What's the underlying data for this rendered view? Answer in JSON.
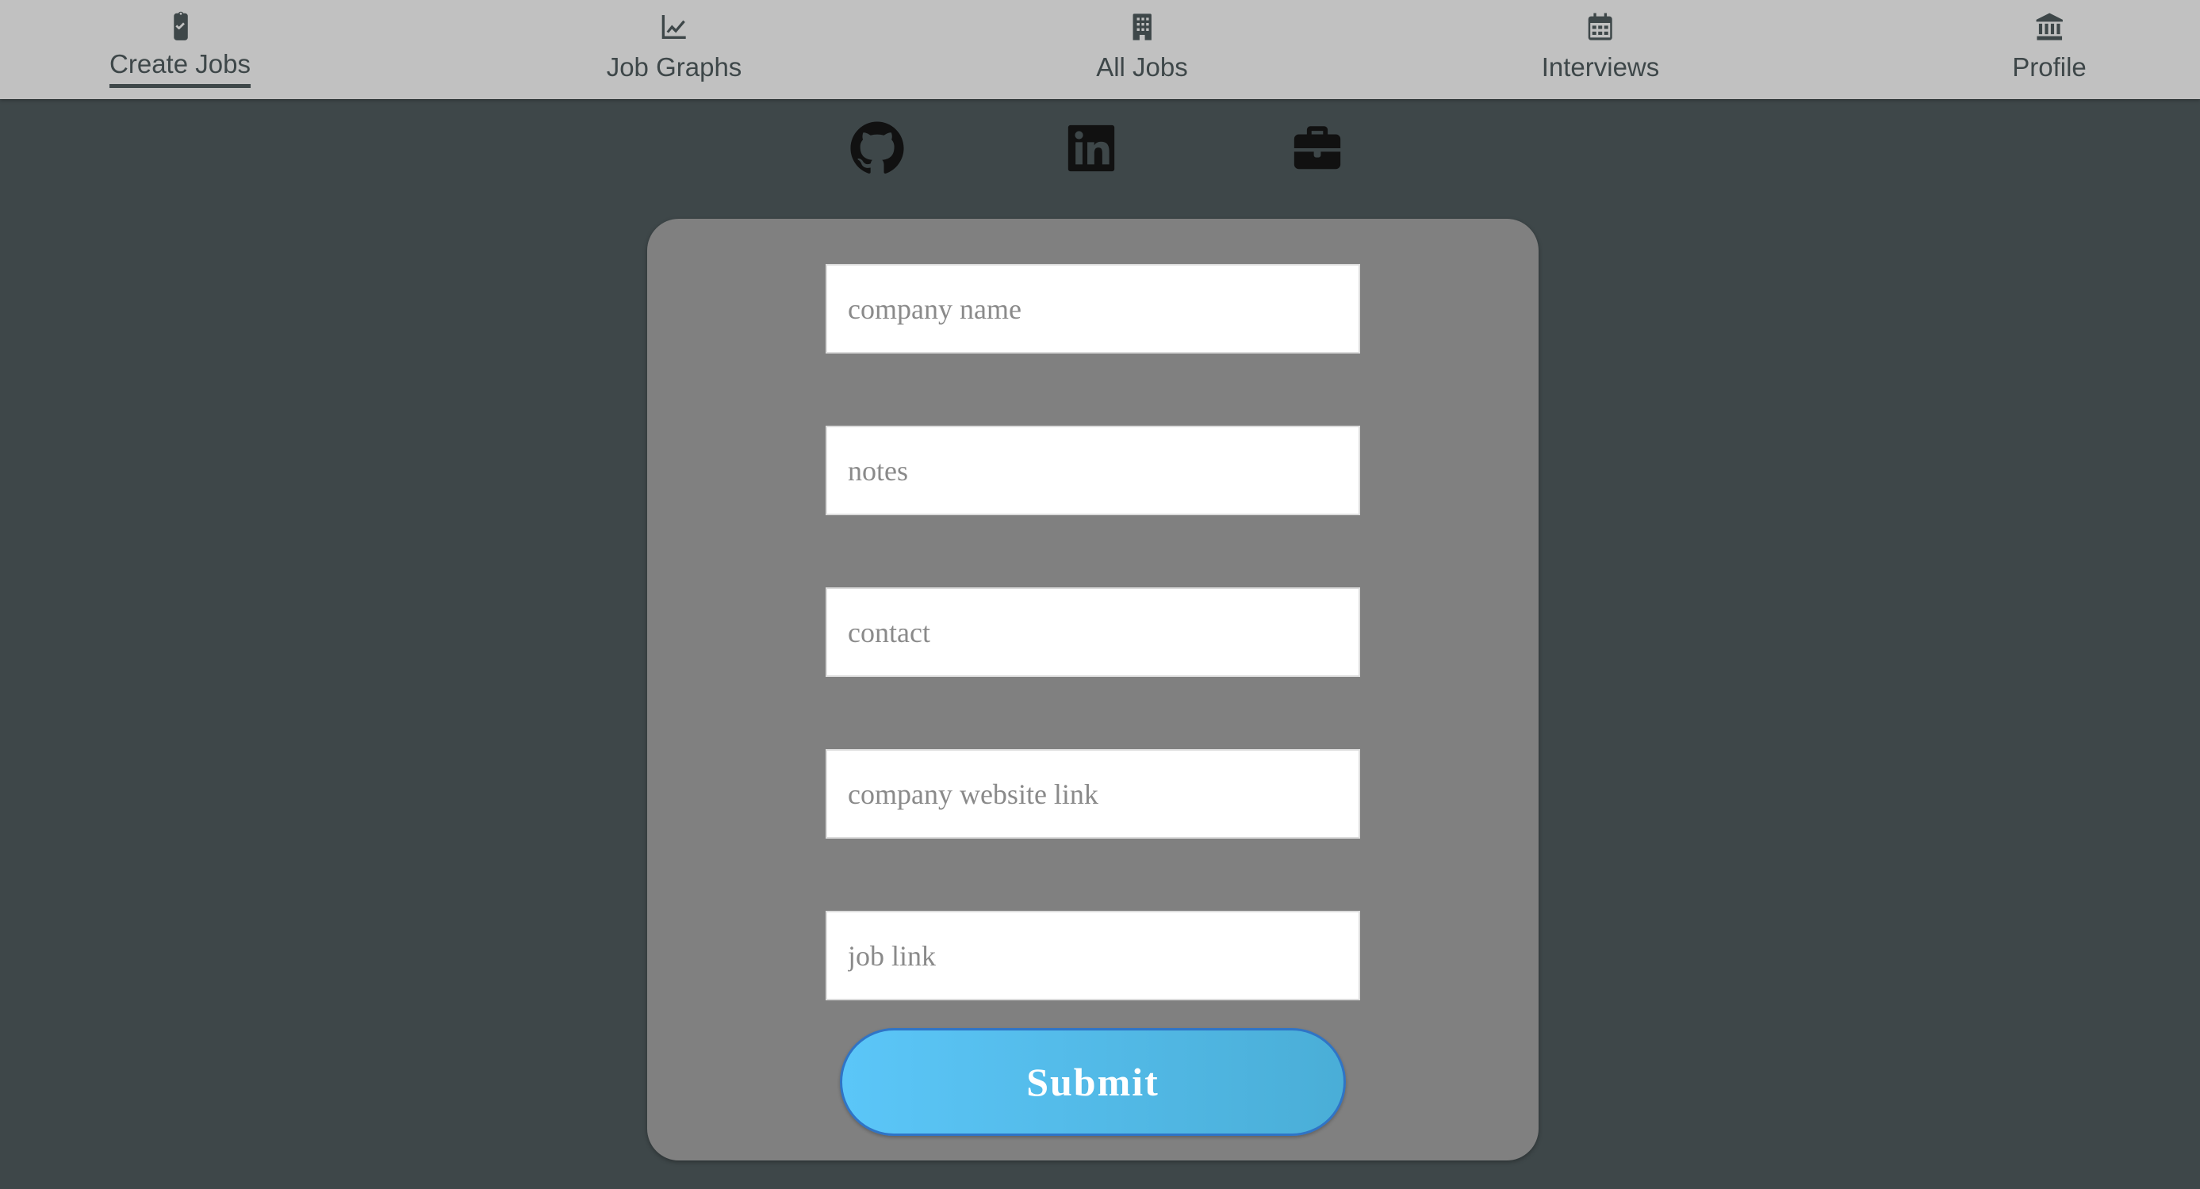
{
  "nav": {
    "items": [
      {
        "label": "Create Jobs",
        "icon": "clipboard-check-icon",
        "active": true
      },
      {
        "label": "Job Graphs",
        "icon": "line-chart-icon",
        "active": false
      },
      {
        "label": "All Jobs",
        "icon": "building-icon",
        "active": false
      },
      {
        "label": "Interviews",
        "icon": "calendar-icon",
        "active": false
      },
      {
        "label": "Profile",
        "icon": "bank-icon",
        "active": false
      }
    ]
  },
  "social": {
    "links": [
      {
        "icon": "github-icon"
      },
      {
        "icon": "linkedin-icon"
      },
      {
        "icon": "briefcase-icon"
      }
    ]
  },
  "form": {
    "fields": [
      {
        "placeholder": "company name",
        "value": ""
      },
      {
        "placeholder": "notes",
        "value": ""
      },
      {
        "placeholder": "contact",
        "value": ""
      },
      {
        "placeholder": "company website link",
        "value": ""
      },
      {
        "placeholder": "job link",
        "value": ""
      }
    ],
    "submit_label": "Submit"
  },
  "colors": {
    "background": "#3e4749",
    "navbar": "#c1c1c1",
    "card": "#808080",
    "submit_gradient_start": "#5bc6f8",
    "submit_gradient_end": "#4aaed7",
    "submit_border": "#2f74c6"
  }
}
